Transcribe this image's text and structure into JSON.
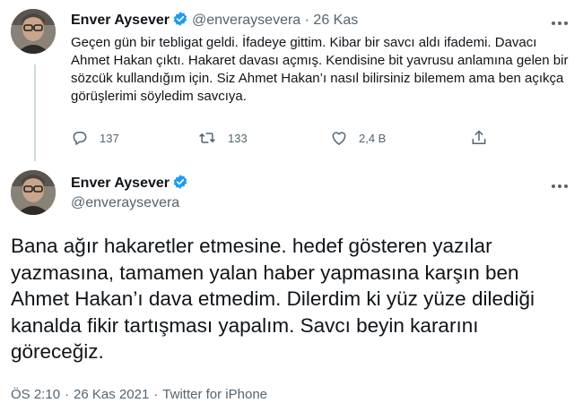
{
  "tweet1": {
    "display_name": "Enver Aysever",
    "handle": "@enveraysevera",
    "separator": "·",
    "date": "26 Kas",
    "text": "Geçen gün bir tebligat geldi. İfadeye gittim. Kibar bir savcı aldı ifademi. Davacı Ahmet Hakan çıktı. Hakaret davası açmış. Kendisine bit yavrusu anlamına gelen bir sözcük kullandığım için. Siz Ahmet Hakan’ı nasıl bilirsiniz bilemem ama ben açıkça görüşlerimi söyledim savcıya.",
    "replies": "137",
    "retweets": "133",
    "likes": "2,4 B"
  },
  "tweet2": {
    "display_name": "Enver Aysever",
    "handle": "@enveraysevera",
    "text": "Bana ağır hakaretler etmesine. hedef gösteren yazılar yazmasına, tamamen yalan haber yapmasına karşın ben Ahmet Hakan’ı dava etmedim. Dilerdim ki yüz yüze dilediği kanalda fikir tartışması yapalım. Savcı beyin kararını göreceğiz.",
    "time": "ÖS 2:10",
    "date": "26 Kas 2021",
    "separator": "·",
    "source": "Twitter for iPhone"
  },
  "icons": {
    "verified": "verified-badge-icon",
    "more": "more-options-icon",
    "reply": "reply-icon",
    "retweet": "retweet-icon",
    "like": "heart-icon",
    "share": "share-icon"
  },
  "colors": {
    "text": "#0f1419",
    "secondary": "#536471",
    "verified": "#1d9bf0",
    "thread_line": "#cfd9de"
  }
}
